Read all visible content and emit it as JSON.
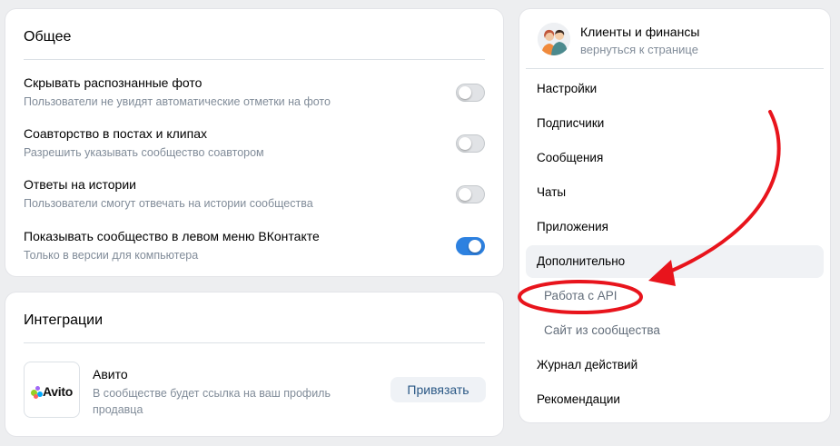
{
  "general": {
    "title": "Общее",
    "settings": [
      {
        "title": "Скрывать распознанные фото",
        "desc": "Пользователи не увидят автоматические отметки на фото",
        "on": false
      },
      {
        "title": "Соавторство в постах и клипах",
        "desc": "Разрешить указывать сообщество соавтором",
        "on": false
      },
      {
        "title": "Ответы на истории",
        "desc": "Пользователи смогут отвечать на истории сообщества",
        "on": false
      },
      {
        "title": "Показывать сообщество в левом меню ВКонтакте",
        "desc": "Только в версии для компьютера",
        "on": true
      }
    ]
  },
  "integrations": {
    "title": "Интеграции",
    "avito": {
      "logo_text": "Avito",
      "name": "Авито",
      "desc": "В сообществе будет ссылка на ваш профиль продавца",
      "button": "Привязать"
    }
  },
  "group": {
    "name": "Клиенты и финансы",
    "back": "вернуться к странице"
  },
  "nav": [
    {
      "label": "Настройки"
    },
    {
      "label": "Подписчики"
    },
    {
      "label": "Сообщения"
    },
    {
      "label": "Чаты"
    },
    {
      "label": "Приложения"
    },
    {
      "label": "Дополнительно",
      "active": true
    },
    {
      "label": "Работа с API",
      "sub": true
    },
    {
      "label": "Сайт из сообщества",
      "sub": true
    },
    {
      "label": "Журнал действий"
    },
    {
      "label": "Рекомендации"
    }
  ],
  "colors": {
    "accent": "#2d81e0",
    "annotation": "#e8141c"
  }
}
